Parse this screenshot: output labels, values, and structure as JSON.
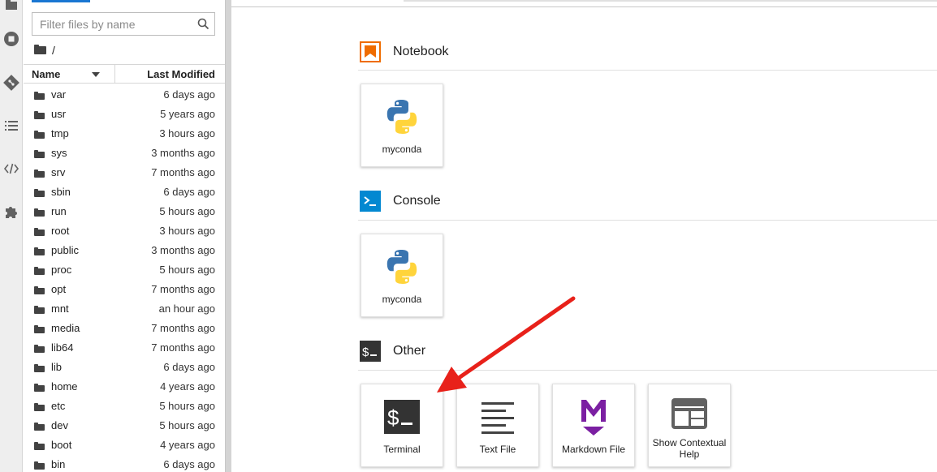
{
  "filebrowser": {
    "filter_placeholder": "Filter files by name",
    "breadcrumb_path": "/",
    "columns": {
      "name": "Name",
      "modified": "Last Modified"
    },
    "rows": [
      {
        "name": "var",
        "modified": "6 days ago"
      },
      {
        "name": "usr",
        "modified": "5 years ago"
      },
      {
        "name": "tmp",
        "modified": "3 hours ago"
      },
      {
        "name": "sys",
        "modified": "3 months ago"
      },
      {
        "name": "srv",
        "modified": "7 months ago"
      },
      {
        "name": "sbin",
        "modified": "6 days ago"
      },
      {
        "name": "run",
        "modified": "5 hours ago"
      },
      {
        "name": "root",
        "modified": "3 hours ago"
      },
      {
        "name": "public",
        "modified": "3 months ago"
      },
      {
        "name": "proc",
        "modified": "5 hours ago"
      },
      {
        "name": "opt",
        "modified": "7 months ago"
      },
      {
        "name": "mnt",
        "modified": "an hour ago"
      },
      {
        "name": "media",
        "modified": "7 months ago"
      },
      {
        "name": "lib64",
        "modified": "7 months ago"
      },
      {
        "name": "lib",
        "modified": "6 days ago"
      },
      {
        "name": "home",
        "modified": "4 years ago"
      },
      {
        "name": "etc",
        "modified": "5 hours ago"
      },
      {
        "name": "dev",
        "modified": "5 hours ago"
      },
      {
        "name": "boot",
        "modified": "4 years ago"
      },
      {
        "name": "bin",
        "modified": "6 days ago"
      }
    ]
  },
  "launcher": {
    "notebook": {
      "title": "Notebook",
      "kernels": [
        {
          "label": "myconda",
          "icon": "python-icon"
        }
      ]
    },
    "console": {
      "title": "Console",
      "kernels": [
        {
          "label": "myconda",
          "icon": "python-icon"
        }
      ]
    },
    "other": {
      "title": "Other",
      "items": [
        {
          "label": "Terminal",
          "icon": "terminal-icon"
        },
        {
          "label": "Text File",
          "icon": "text-file-icon"
        },
        {
          "label": "Markdown File",
          "icon": "markdown-icon"
        },
        {
          "label": "Show Contextual Help",
          "icon": "contextual-help-icon"
        }
      ]
    }
  },
  "colors": {
    "accent": "#1976d2",
    "notebook_orange": "#ef6c00",
    "console_blue": "#0288d1",
    "terminal_dark": "#333333",
    "markdown_purple": "#7b1fa2",
    "python_blue": "#3a75b0",
    "python_yellow": "#ffd43b",
    "annotation_red": "#e8211a"
  }
}
